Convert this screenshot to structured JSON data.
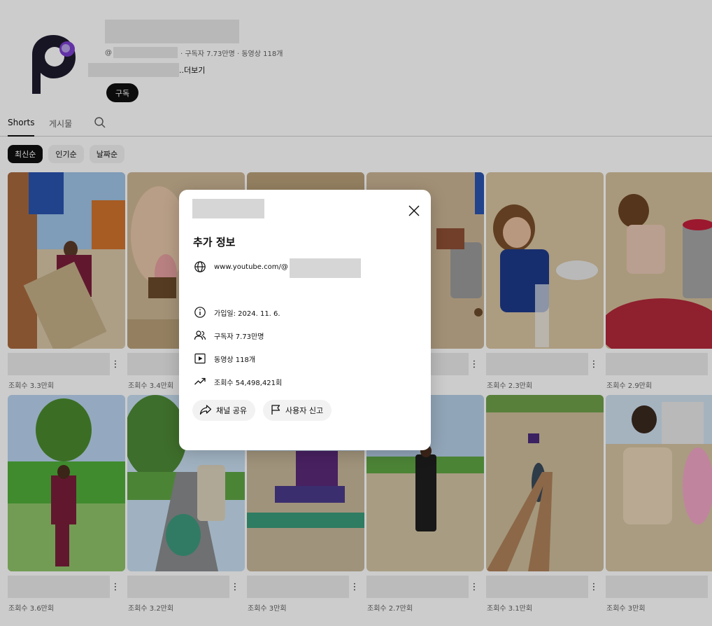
{
  "channel": {
    "handle_prefix": "@",
    "stats": "· 구독자 7.73만명 · 동영상 118개",
    "description_more": "..더보기",
    "subscribe_label": "구독"
  },
  "tabs": [
    {
      "label": "Shorts",
      "active": true
    },
    {
      "label": "게시물",
      "active": false
    }
  ],
  "chips": [
    {
      "label": "최신순",
      "active": true
    },
    {
      "label": "인기순",
      "active": false
    },
    {
      "label": "날짜순",
      "active": false
    }
  ],
  "shorts": [
    {
      "views": "조회수 3.3만회"
    },
    {
      "views": "조회수 3.4만회"
    },
    {
      "views": ""
    },
    {
      "views": ""
    },
    {
      "views": "조회수 2.3만회"
    },
    {
      "views": "조회수 2.9만회"
    },
    {
      "views": "조회수 3.6만회"
    },
    {
      "views": "조회수 3.2만회"
    },
    {
      "views": "조회수 3만회"
    },
    {
      "views": "조회수 2.7만회"
    },
    {
      "views": "조회수 3.1만회"
    },
    {
      "views": "조회수 3만회"
    }
  ],
  "about_dialog": {
    "heading": "추가 정보",
    "url_prefix": "www.youtube.com/@",
    "joined": "가입일: 2024. 11. 6.",
    "subscribers": "구독자 7.73만명",
    "videos": "동영상 118개",
    "views": "조회수 54,498,421회",
    "share_label": "채널 공유",
    "report_label": "사용자 신고"
  },
  "colors": {
    "text_primary": "#0f0f0f",
    "text_secondary": "#606060",
    "chip_bg": "#f2f2f2",
    "logo_dark": "#1d1b2e",
    "logo_accent": "#7b3fd0"
  },
  "icons": [
    "globe-icon",
    "info-icon",
    "people-icon",
    "video-icon",
    "trending-icon",
    "share-icon",
    "flag-icon",
    "close-icon",
    "search-icon",
    "more-vert-icon"
  ]
}
